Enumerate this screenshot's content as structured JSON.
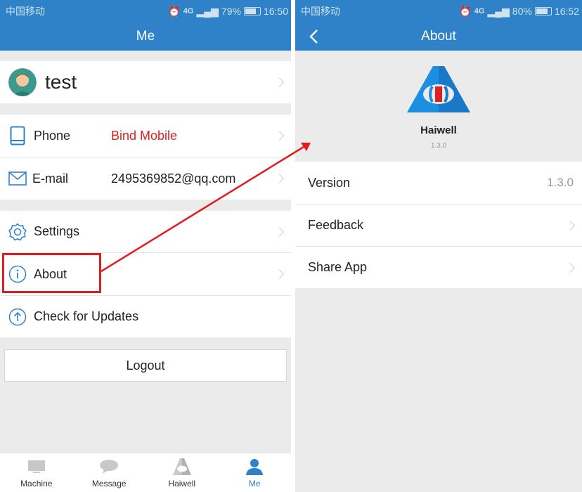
{
  "left": {
    "status": {
      "carrier": "中国移动",
      "network": "4G",
      "battery": "79%",
      "battery_level": 0.79,
      "time": "16:50"
    },
    "nav_title": "Me",
    "profile": {
      "name": "test"
    },
    "contact": [
      {
        "label": "Phone",
        "value": "Bind Mobile"
      },
      {
        "label": "E-mail",
        "value": "2495369852@qq.com"
      }
    ],
    "menu": [
      {
        "label": "Settings"
      },
      {
        "label": "About"
      },
      {
        "label": "Check for Updates"
      }
    ],
    "logout": "Logout",
    "tabs": [
      {
        "label": "Machine",
        "icon": "monitor-icon"
      },
      {
        "label": "Message",
        "icon": "chat-bubble-icon"
      },
      {
        "label": "Haiwell",
        "icon": "haiwell-logo-icon"
      },
      {
        "label": "Me",
        "icon": "person-icon",
        "active": true
      }
    ]
  },
  "right": {
    "status": {
      "carrier": "中国移动",
      "network": "4G",
      "battery": "80%",
      "battery_level": 0.8,
      "time": "16:52"
    },
    "nav_title": "About",
    "app": {
      "name": "Haiwell",
      "version": "1.3.0"
    },
    "rows": [
      {
        "label": "Version",
        "value": "1.3.0"
      },
      {
        "label": "Feedback"
      },
      {
        "label": "Share App"
      }
    ]
  },
  "colors": {
    "accent": "#2f82c8",
    "annotation": "#e31b1b",
    "warning_text": "#e02020",
    "background": "#ebebeb"
  }
}
